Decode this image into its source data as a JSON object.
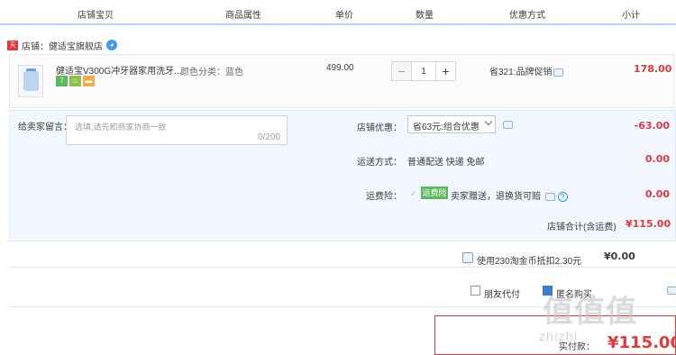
{
  "header": {
    "columns": [
      "店铺宝贝",
      "商品属性",
      "单价",
      "数量",
      "优惠方式",
      "小计"
    ]
  },
  "shop": {
    "badge": "天",
    "label": "店铺：健适宝旗舰店"
  },
  "item": {
    "title": "健适宝V300G冲牙器家用洗牙...",
    "sku": "颜色分类：蓝色",
    "unit_price": "499.00",
    "quantity": "1",
    "minus": "−",
    "plus": "+",
    "promo": "省321:品牌促销",
    "subtotal": "178.00",
    "service_icons": [
      {
        "text": "7",
        "color": "#5cb85c"
      },
      {
        "text": "♨",
        "color": "#8bc34a"
      },
      {
        "text": "▬",
        "color": "#f0ad4e"
      }
    ]
  },
  "order": {
    "message_label": "给卖家留言：",
    "message_placeholder": "选填,请先和商家协商一致",
    "message_count": "0/200",
    "coupon_label": "店铺优惠：",
    "coupon_value": "省63元:组合优惠",
    "coupon_amount": "-63.00",
    "shipping_label": "运送方式：",
    "shipping_value": "普通配送 快递 免邮",
    "shipping_amount": "0.00",
    "insurance_label": "运费险：",
    "insurance_tag": "运费险",
    "insurance_text": "卖家赠送，退换货可赔",
    "insurance_amount": "0.00",
    "shop_total_label": "店铺合计(含运费)",
    "shop_total_value": "¥115.00"
  },
  "coins": {
    "label": "使用230淘金币抵扣2.30元",
    "value": "¥0.00"
  },
  "pay_options": {
    "friend_label": "朋友代付",
    "anonymous_label": "匿名购买"
  },
  "actual_pay": {
    "label": "实付款：",
    "value": "¥115.00"
  },
  "watermark": {
    "text": "值值值",
    "sub": "zhizhi"
  }
}
